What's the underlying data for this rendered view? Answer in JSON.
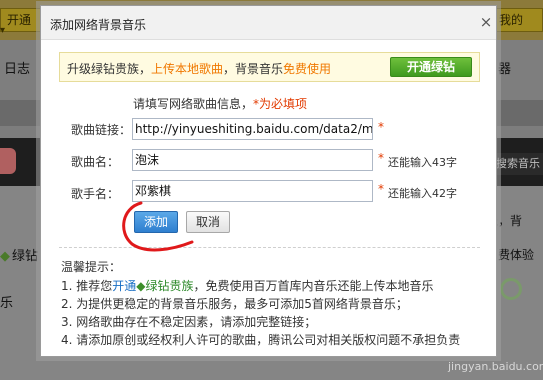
{
  "background": {
    "top_left_button": "开通",
    "top_right_button": "我的",
    "nav_left": "日志",
    "nav_right": "器",
    "search_text": "搜索音乐",
    "left_gem_text": "绿钻",
    "left_text_2": "乐",
    "right_text_1": "乐，背",
    "right_text_2": "费体验"
  },
  "dialog": {
    "title": "添加网络背景音乐",
    "close_glyph": "×",
    "promo": {
      "prefix": "升级绿钻贵族，",
      "highlight1": "上传本地歌曲",
      "middle": "，背景音乐",
      "highlight2": "免费使用",
      "button": "开通绿钻"
    },
    "hint": "请填写网络歌曲信息，",
    "hint_required": "*为必填项",
    "song_url": {
      "label": "歌曲链接：",
      "value": "http://yinyueshiting.baidu.com/data2/music"
    },
    "song_name": {
      "label": "歌曲名：",
      "value": "泡沫",
      "remaining": "还能输入43字"
    },
    "singer_name": {
      "label": "歌手名：",
      "value": "邓紫棋",
      "remaining": "还能输入42字"
    },
    "required_mark": "*",
    "add_button": "添加",
    "cancel_button": "取消",
    "tips_title": "温馨提示：",
    "tips": {
      "t1_prefix": "1. 推荐您",
      "t1_link": "开通",
      "t1_link2": "绿钻贵族",
      "t1_suffix": "，免费使用百万首库内音乐还能上传本地音乐",
      "t2": "2. 为提供更稳定的背景音乐服务，最多可添加5首网络背景音乐；",
      "t3": "3. 网络歌曲存在不稳定因素，请添加完整链接；",
      "t4": "4. 请添加原创或经权利人许可的歌曲，腾讯公司对相关版权问题不承担负责"
    }
  },
  "watermark": "jingyan.baidu.com",
  "colors": {
    "accent_orange": "#f07800",
    "required_red": "#e23a00",
    "link_blue": "#1a6fc4",
    "green_button": "#3f9a1f",
    "add_button_blue": "#2f7fcf",
    "annotation_red": "#e0191b"
  }
}
